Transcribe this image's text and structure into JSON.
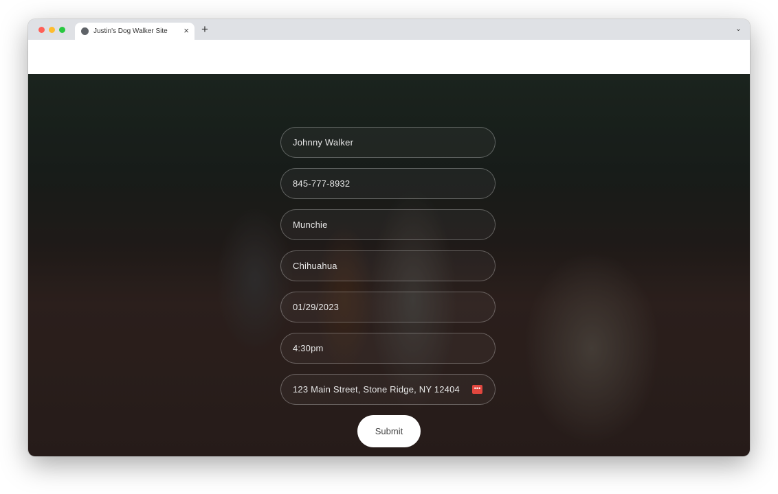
{
  "browser": {
    "tab_title": "Justin's Dog Walker Site",
    "close_label": "×",
    "new_tab_label": "+",
    "menu_label": "⌄",
    "traffic_lights": [
      "#ff5f57",
      "#febc2e",
      "#28c840"
    ]
  },
  "form": {
    "fields": [
      {
        "value": "Johnny Walker"
      },
      {
        "value": "845-777-8932"
      },
      {
        "value": "Munchie"
      },
      {
        "value": "Chihuahua"
      },
      {
        "value": "01/29/2023"
      },
      {
        "value": "4:30pm"
      },
      {
        "value": "123 Main Street, Stone Ridge, NY 12404",
        "icon": "password-manager-icon",
        "icon_color": "#e0463e"
      }
    ],
    "submit_label": "Submit"
  }
}
